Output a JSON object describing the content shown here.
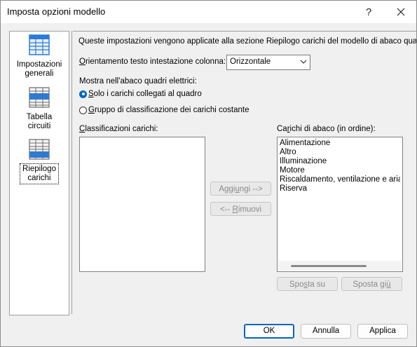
{
  "window": {
    "title": "Imposta opzioni modello",
    "help_glyph": "?",
    "close_glyph": "✕"
  },
  "nav": {
    "items": [
      {
        "label_line1": "Impostazioni",
        "label_line2": "generali",
        "icon": "settings-table-icon"
      },
      {
        "label_line1": "Tabella",
        "label_line2": "circuiti",
        "icon": "circuit-table-icon"
      },
      {
        "label_line1": "Riepilogo",
        "label_line2": "carichi",
        "icon": "load-summary-icon",
        "selected": true
      }
    ]
  },
  "panel": {
    "description": "Queste impostazioni vengono applicate alla sezione Riepilogo carichi del modello di abaco quadri elettrici.",
    "orientation_label_u": "O",
    "orientation_label_rest": "rientamento testo intestazione colonna:",
    "orientation_value": "Orizzontale",
    "show_label": "Mostra nell'abaco quadri elettrici:",
    "radio1_u": "S",
    "radio1_rest": "olo i carichi collegati al quadro",
    "radio2_u": "G",
    "radio2_rest": "ruppo di classificazione dei carichi costante",
    "classifications_label_u": "C",
    "classifications_label_rest": "lassificazioni carichi:",
    "loads_label_pre": "Ca",
    "loads_label_u": "r",
    "loads_label_rest": "ichi di abaco (in ordine):",
    "loads_items": [
      "Alimentazione",
      "Altro",
      "Illuminazione",
      "Motore",
      "Riscaldamento, ventilazione e aria condizionata",
      "Riserva"
    ],
    "add_pre": "Aggi",
    "add_u": "u",
    "add_rest": "ngi -->",
    "remove_pre": "<-- ",
    "remove_u": "R",
    "remove_rest": "imuovi",
    "move_up_pre": "Spo",
    "move_up_u": "s",
    "move_up_rest": "ta su",
    "move_down_pre": "Sposta gi",
    "move_down_u": "ù",
    "move_down_rest": ""
  },
  "footer": {
    "ok": "OK",
    "cancel": "Annulla",
    "apply": "Applica"
  },
  "colors": {
    "accent": "#0067c0",
    "icon_blue": "#2b7bd8"
  }
}
